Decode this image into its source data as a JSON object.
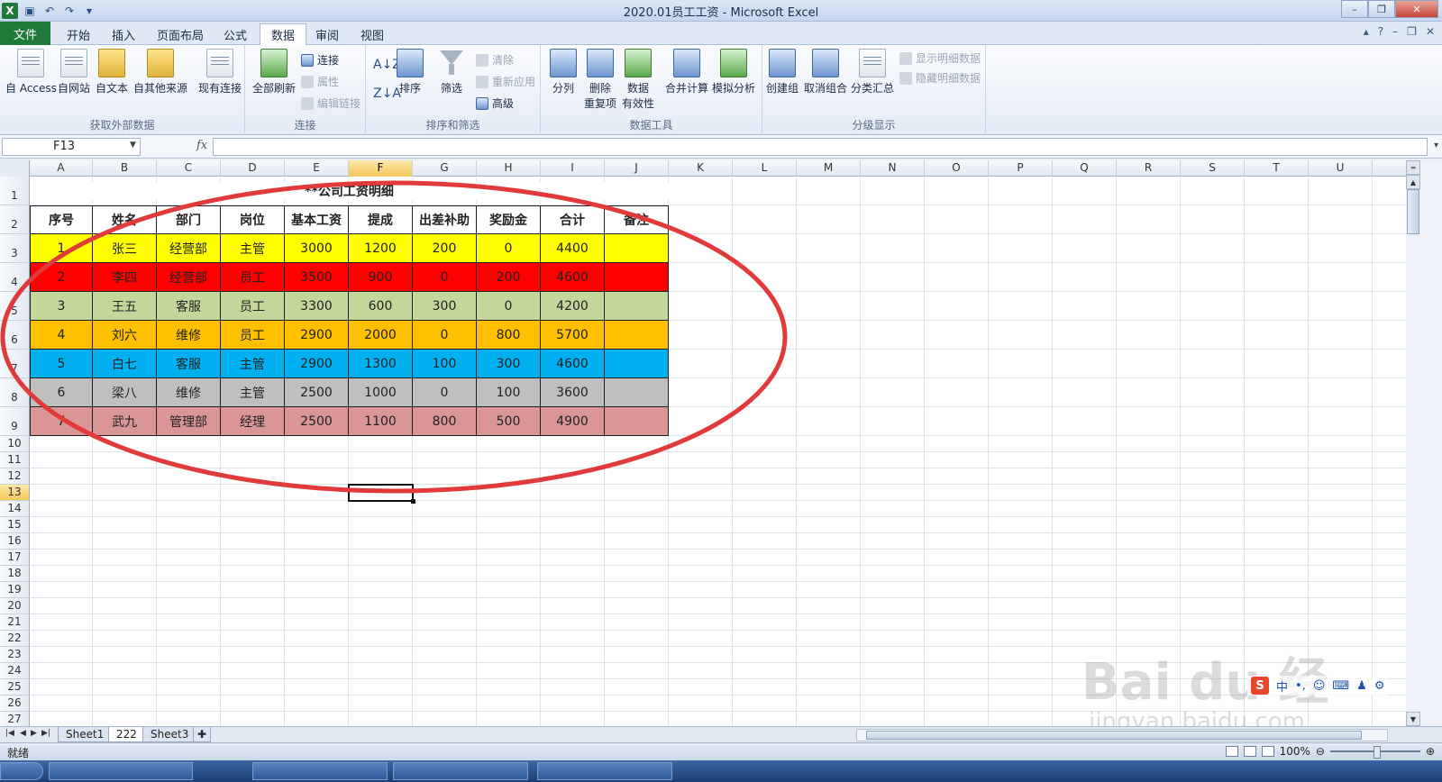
{
  "window": {
    "title": "2020.01员工工资 - Microsoft Excel",
    "controls": [
      "–",
      "❐",
      "✕"
    ]
  },
  "tabs": [
    "文件",
    "开始",
    "插入",
    "页面布局",
    "公式",
    "数据",
    "审阅",
    "视图"
  ],
  "active_tab": "数据",
  "ribbon": {
    "groups": [
      {
        "label": "获取外部数据",
        "buttons": [
          "自 Access",
          "自网站",
          "自文本",
          "自其他来源",
          "现有连接"
        ]
      },
      {
        "label": "连接",
        "buttons": [
          "全部刷新"
        ],
        "small": [
          "连接",
          "属性",
          "编辑链接"
        ]
      },
      {
        "label": "排序和筛选",
        "buttons": [
          "排序",
          "筛选"
        ],
        "small": [
          "清除",
          "重新应用",
          "高级"
        ]
      },
      {
        "label": "数据工具",
        "buttons": [
          "分列",
          "删除\n重复项",
          "数据\n有效性",
          "合并计算",
          "模拟分析"
        ]
      },
      {
        "label": "分级显示",
        "buttons": [
          "创建组",
          "取消组合",
          "分类汇总"
        ],
        "small": [
          "显示明细数据",
          "隐藏明细数据"
        ]
      }
    ]
  },
  "formula_bar": {
    "name_box": "F13",
    "fx": "fx",
    "formula": ""
  },
  "columns": [
    "A",
    "B",
    "C",
    "D",
    "E",
    "F",
    "G",
    "H",
    "I",
    "J",
    "K",
    "L",
    "M",
    "N",
    "O",
    "P",
    "Q",
    "R",
    "S",
    "T",
    "U"
  ],
  "rows": [
    "1",
    "2",
    "3",
    "4",
    "5",
    "6",
    "7",
    "8",
    "9",
    "10",
    "11",
    "12",
    "13",
    "14",
    "15",
    "16",
    "17",
    "18",
    "19",
    "20",
    "21",
    "22",
    "23",
    "24",
    "25",
    "26",
    "27"
  ],
  "selected_cell": "F13",
  "sheet": {
    "title": "**公司工资明细",
    "headers": [
      "序号",
      "姓名",
      "部门",
      "岗位",
      "基本工资",
      "提成",
      "出差补助",
      "奖励金",
      "合计",
      "备注"
    ],
    "rows": [
      {
        "cells": [
          "1",
          "张三",
          "经营部",
          "主管",
          "3000",
          "1200",
          "200",
          "0",
          "4400",
          ""
        ],
        "color": "#ffff00"
      },
      {
        "cells": [
          "2",
          "李四",
          "经营部",
          "员工",
          "3500",
          "900",
          "0",
          "200",
          "4600",
          ""
        ],
        "color": "#ff0000"
      },
      {
        "cells": [
          "3",
          "王五",
          "客服",
          "员工",
          "3300",
          "600",
          "300",
          "0",
          "4200",
          ""
        ],
        "color": "#c4d79b"
      },
      {
        "cells": [
          "4",
          "刘六",
          "维修",
          "员工",
          "2900",
          "2000",
          "0",
          "800",
          "5700",
          ""
        ],
        "color": "#ffc000"
      },
      {
        "cells": [
          "5",
          "白七",
          "客服",
          "主管",
          "2900",
          "1300",
          "100",
          "300",
          "4600",
          ""
        ],
        "color": "#00b0f0"
      },
      {
        "cells": [
          "6",
          "梁八",
          "维修",
          "主管",
          "2500",
          "1000",
          "0",
          "100",
          "3600",
          ""
        ],
        "color": "#bfbfbf"
      },
      {
        "cells": [
          "7",
          "武九",
          "管理部",
          "经理",
          "2500",
          "1100",
          "800",
          "500",
          "4900",
          ""
        ],
        "color": "#da9694"
      }
    ]
  },
  "sheet_tabs": [
    "Sheet1",
    "222",
    "Sheet3"
  ],
  "active_sheet": "222",
  "status": {
    "text": "就绪",
    "zoom": "100%"
  },
  "ime": {
    "items": [
      "中",
      "•,",
      "☺",
      "⌨",
      "♟",
      "⚙"
    ]
  },
  "watermark": {
    "text": "Bai du 经验",
    "sub": "jingyan.baidu.com"
  },
  "annotation_color": "#e03a3a"
}
